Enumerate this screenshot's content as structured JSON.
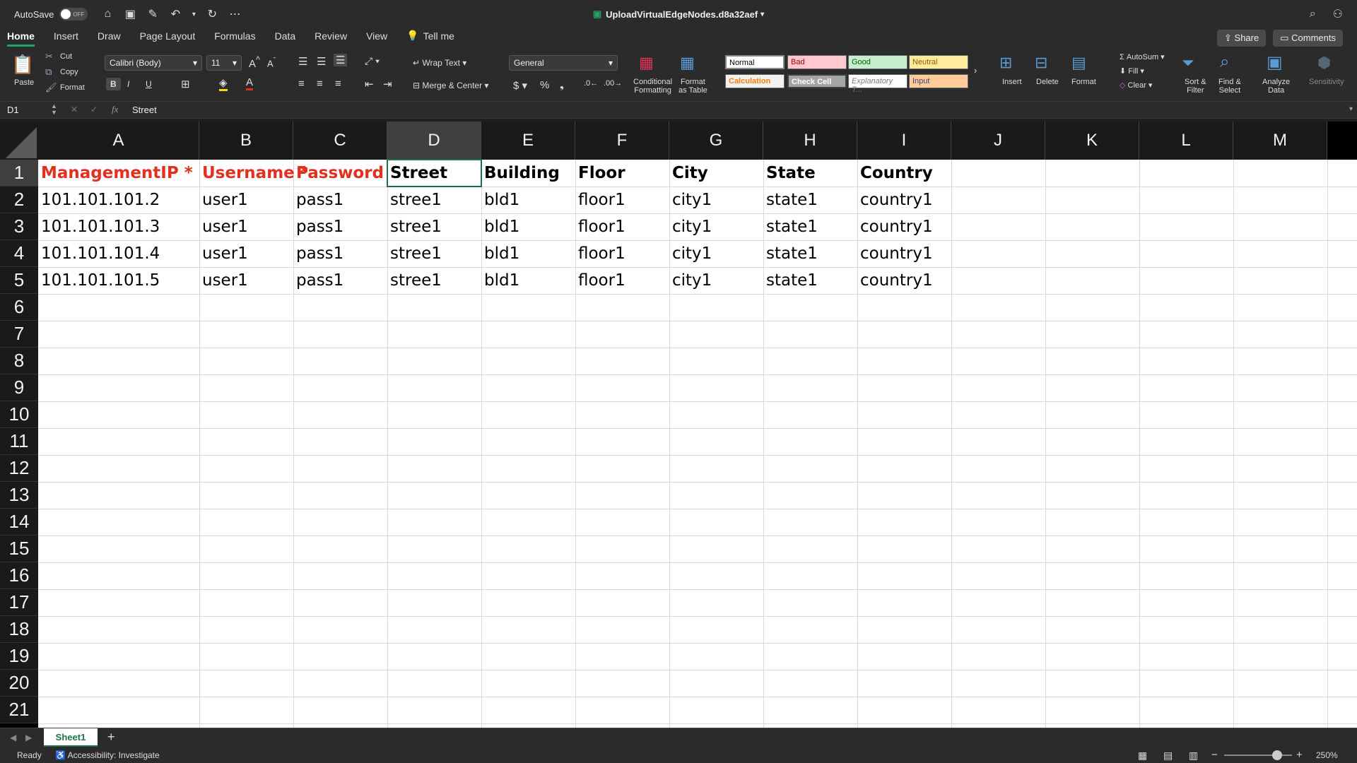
{
  "app": {
    "autosave_label": "AutoSave",
    "autosave_state": "OFF",
    "doc_title": "UploadVirtualEdgeNodes.d8a32aef"
  },
  "tabs": [
    "Home",
    "Insert",
    "Draw",
    "Page Layout",
    "Formulas",
    "Data",
    "Review",
    "View"
  ],
  "tell_me": "Tell me",
  "share_label": "Share",
  "comments_label": "Comments",
  "ribbon": {
    "paste": "Paste",
    "cut": "Cut",
    "copy": "Copy",
    "format_painter": "Format",
    "font_name": "Calibri (Body)",
    "font_size": "11",
    "wrap_text": "Wrap Text",
    "merge_center": "Merge & Center",
    "number_format": "General",
    "cond_fmt_1": "Conditional",
    "cond_fmt_2": "Formatting",
    "fmt_table_1": "Format",
    "fmt_table_2": "as Table",
    "styles": {
      "normal": "Normal",
      "bad": "Bad",
      "good": "Good",
      "neutral": "Neutral",
      "calculation": "Calculation",
      "check_cell": "Check Cell",
      "explanatory": "Explanatory T...",
      "input": "Input"
    },
    "insert": "Insert",
    "delete": "Delete",
    "format": "Format",
    "autosum": "AutoSum",
    "fill": "Fill",
    "clear": "Clear",
    "sort_1": "Sort &",
    "sort_2": "Filter",
    "find_1": "Find &",
    "find_2": "Select",
    "analyze_1": "Analyze",
    "analyze_2": "Data",
    "sensitivity": "Sensitivity"
  },
  "formula_bar": {
    "name_box": "D1",
    "fx": "fx",
    "content": "Street"
  },
  "columns": [
    "A",
    "B",
    "C",
    "D",
    "E",
    "F",
    "G",
    "H",
    "I",
    "J",
    "K",
    "L",
    "M"
  ],
  "rows": [
    "1",
    "2",
    "3",
    "4",
    "5",
    "6",
    "7",
    "8",
    "9",
    "10",
    "11",
    "12",
    "13",
    "14",
    "15",
    "16",
    "17",
    "18",
    "19",
    "20",
    "21"
  ],
  "cells": {
    "headers": [
      "ManagementIP *",
      "Username *",
      "Password *",
      "Street",
      "Building",
      "Floor",
      "City",
      "State",
      "Country"
    ],
    "data": [
      [
        "101.101.101.2",
        "user1",
        "pass1",
        "stree1",
        "bld1",
        "floor1",
        "city1",
        "state1",
        "country1"
      ],
      [
        "101.101.101.3",
        "user1",
        "pass1",
        "stree1",
        "bld1",
        "floor1",
        "city1",
        "state1",
        "country1"
      ],
      [
        "101.101.101.4",
        "user1",
        "pass1",
        "stree1",
        "bld1",
        "floor1",
        "city1",
        "state1",
        "country1"
      ],
      [
        "101.101.101.5",
        "user1",
        "pass1",
        "stree1",
        "bld1",
        "floor1",
        "city1",
        "state1",
        "country1"
      ]
    ]
  },
  "sheet": {
    "tab_name": "Sheet1",
    "add": "+"
  },
  "status": {
    "ready": "Ready",
    "accessibility": "Accessibility: Investigate",
    "zoom": "250%"
  },
  "colors": {
    "accent": "#1e7145",
    "required_text": "#e0301e"
  }
}
